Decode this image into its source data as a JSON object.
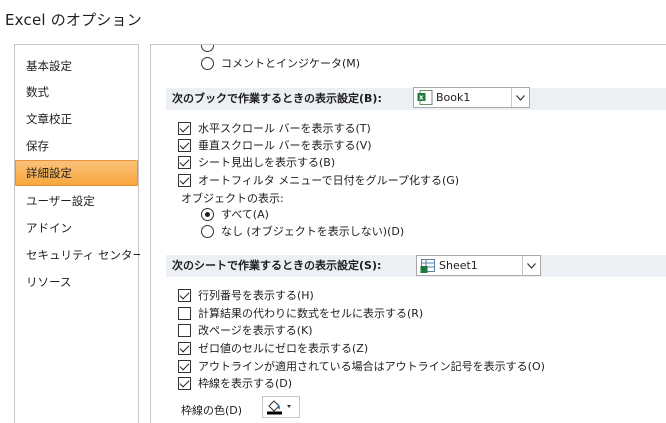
{
  "window": {
    "title": "Excel のオプション"
  },
  "sidebar": {
    "items": [
      {
        "label": "基本設定",
        "active": false
      },
      {
        "label": "数式",
        "active": false
      },
      {
        "label": "文章校正",
        "active": false
      },
      {
        "label": "保存",
        "active": false
      },
      {
        "label": "詳細設定",
        "active": true
      },
      {
        "label": "ユーザー設定",
        "active": false
      },
      {
        "label": "アドイン",
        "active": false
      },
      {
        "label": "セキュリティ センター",
        "active": false
      },
      {
        "label": "リソース",
        "active": false
      }
    ]
  },
  "main": {
    "comment_indicator_option": {
      "label": "コメントとインジケータ(M)",
      "selected": false
    },
    "book_section": {
      "header": "次のブックで作業するときの表示設定(B):",
      "combo_value": "Book1",
      "options": [
        {
          "label": "水平スクロール バーを表示する(T)",
          "checked": true
        },
        {
          "label": "垂直スクロール バーを表示する(V)",
          "checked": true
        },
        {
          "label": "シート見出しを表示する(B)",
          "checked": true
        },
        {
          "label": "オートフィルタ メニューで日付をグループ化する(G)",
          "checked": true
        }
      ],
      "objects_label": "オブジェクトの表示:",
      "objects_options": [
        {
          "label": "すべて(A)",
          "selected": true
        },
        {
          "label": "なし (オブジェクトを表示しない)(D)",
          "selected": false
        }
      ]
    },
    "sheet_section": {
      "header": "次のシートで作業するときの表示設定(S):",
      "combo_value": "Sheet1",
      "options": [
        {
          "label": "行列番号を表示する(H)",
          "checked": true
        },
        {
          "label": "計算結果の代わりに数式をセルに表示する(R)",
          "checked": false
        },
        {
          "label": "改ページを表示する(K)",
          "checked": false
        },
        {
          "label": "ゼロ値のセルにゼロを表示する(Z)",
          "checked": true
        },
        {
          "label": "アウトラインが適用されている場合はアウトライン記号を表示する(O)",
          "checked": true
        },
        {
          "label": "枠線を表示する(D)",
          "checked": true
        }
      ],
      "gridline_color_label": "枠線の色(D)"
    }
  },
  "colors": {
    "accent": "#f7a63c",
    "section_bg": "#eceff3",
    "border": "#c6c6c6"
  }
}
